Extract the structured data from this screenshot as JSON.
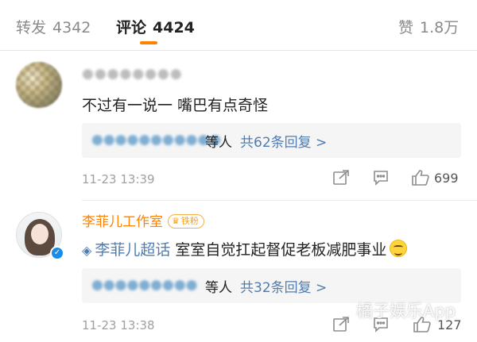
{
  "tabs": [
    {
      "label": "转发",
      "count": "4342"
    },
    {
      "label": "评论",
      "count": "4424"
    },
    {
      "label": "赞",
      "count": "1.8万"
    }
  ],
  "comments": [
    {
      "username": "●●●●●●●●",
      "text": "不过有一说一 嘴巴有点奇怪",
      "reply_names": "●●●●●●●●●●●",
      "reply_suffix": "等人",
      "reply_link": "共62条回复 >",
      "time": "11-23 13:39",
      "likes": "699"
    },
    {
      "username": "李菲儿工作室",
      "badge": "铁粉",
      "topic": "李菲儿超话",
      "text": "室室自觉扛起督促老板减肥事业",
      "reply_names": "●●●●●●●●●",
      "reply_suffix": "等人",
      "reply_link": "共32条回复 >",
      "time": "11-23 13:38",
      "likes": "127"
    }
  ],
  "watermark": "橘子娱乐App",
  "colors": {
    "accent": "#ff8200",
    "link": "#507daf",
    "verified": "#1b8be6"
  },
  "icons": [
    "share-icon",
    "comment-icon",
    "like-icon",
    "topic-icon",
    "verified-icon",
    "crown-icon",
    "smile-emoji-icon"
  ]
}
